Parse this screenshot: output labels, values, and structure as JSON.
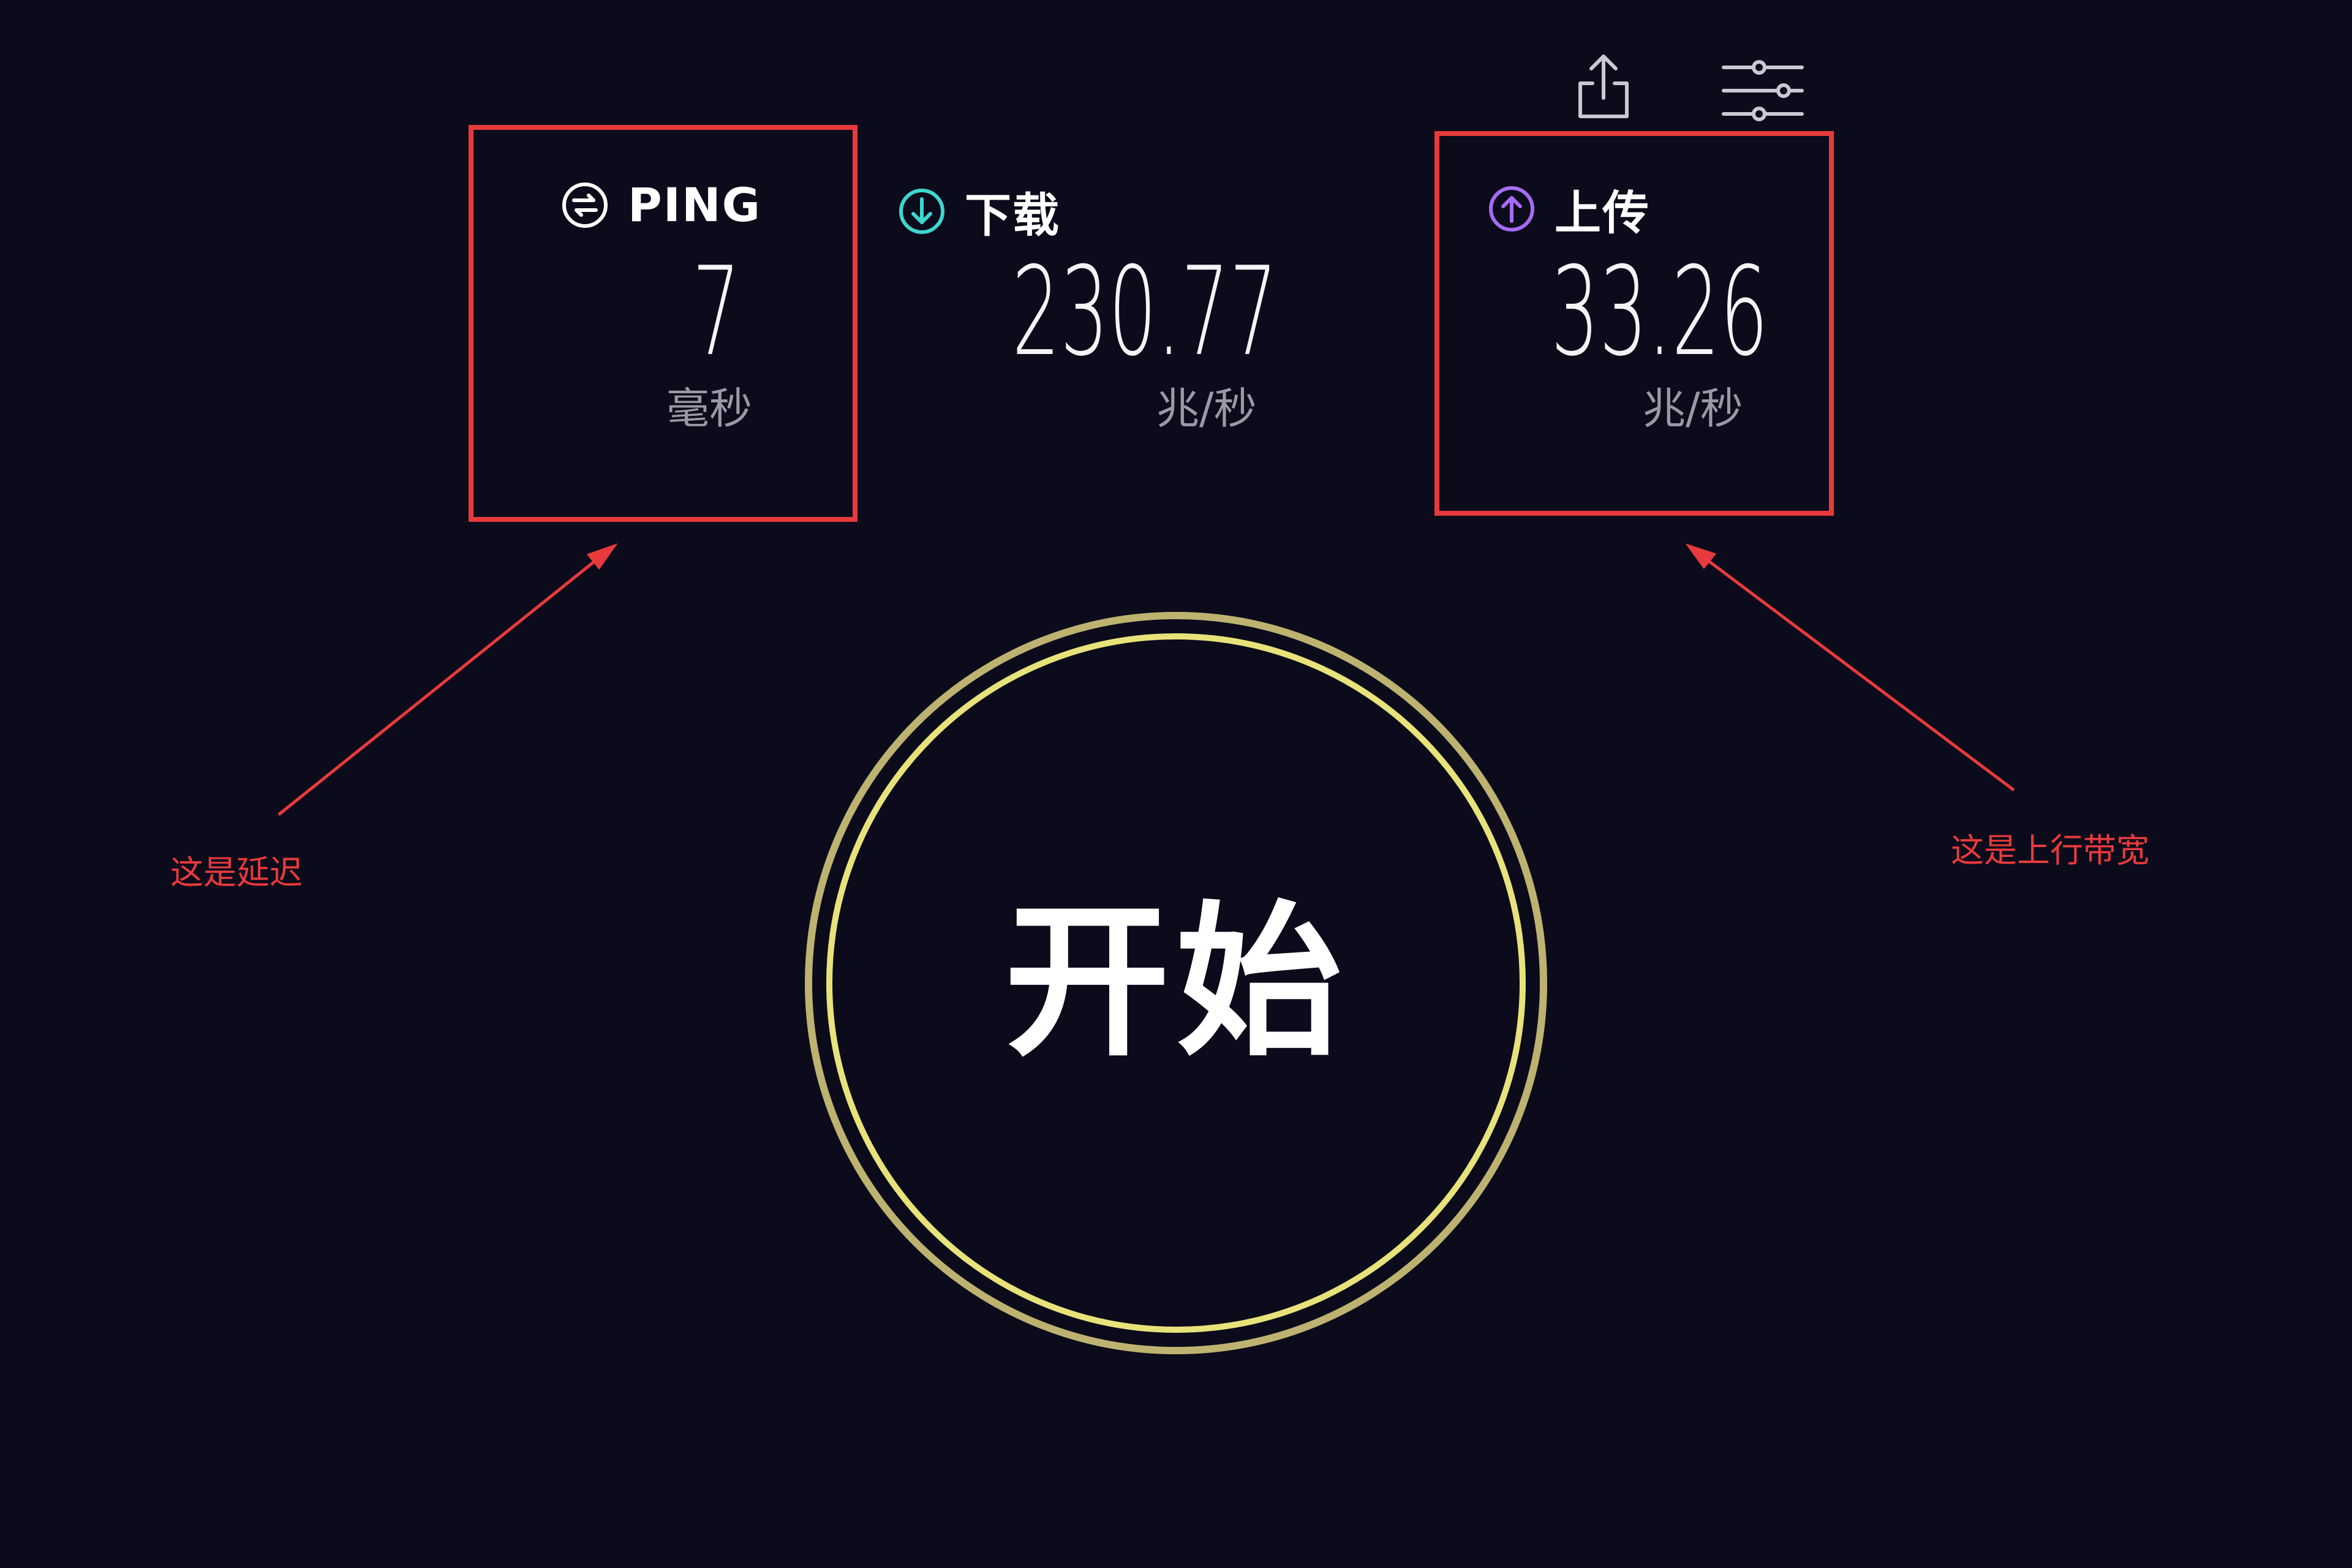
{
  "toolbar": {
    "share_icon": "share-icon",
    "settings_icon": "sliders-icon"
  },
  "metrics": {
    "ping": {
      "icon": "ping-icon",
      "label": "PING",
      "value": "7",
      "unit": "毫秒",
      "icon_color": "#ffffff"
    },
    "download": {
      "icon": "download-arrow-icon",
      "label": "下载",
      "value": "230.77",
      "unit": "兆/秒",
      "icon_color": "#3ed6cf"
    },
    "upload": {
      "icon": "upload-arrow-icon",
      "label": "上传",
      "value": "33.26",
      "unit": "兆/秒",
      "icon_color": "#a66bf2"
    }
  },
  "start_button": {
    "label": "开始",
    "ring_color": "#e8e27a",
    "outer_ring_color": "#bdb270"
  },
  "annotations": {
    "ping_note": "这是延迟",
    "upload_note": "这是上行带宽",
    "color": "#e83a3c"
  },
  "colors": {
    "background": "#0b0b1b",
    "text": "#ffffff",
    "unit_text": "#9a9aa6"
  }
}
